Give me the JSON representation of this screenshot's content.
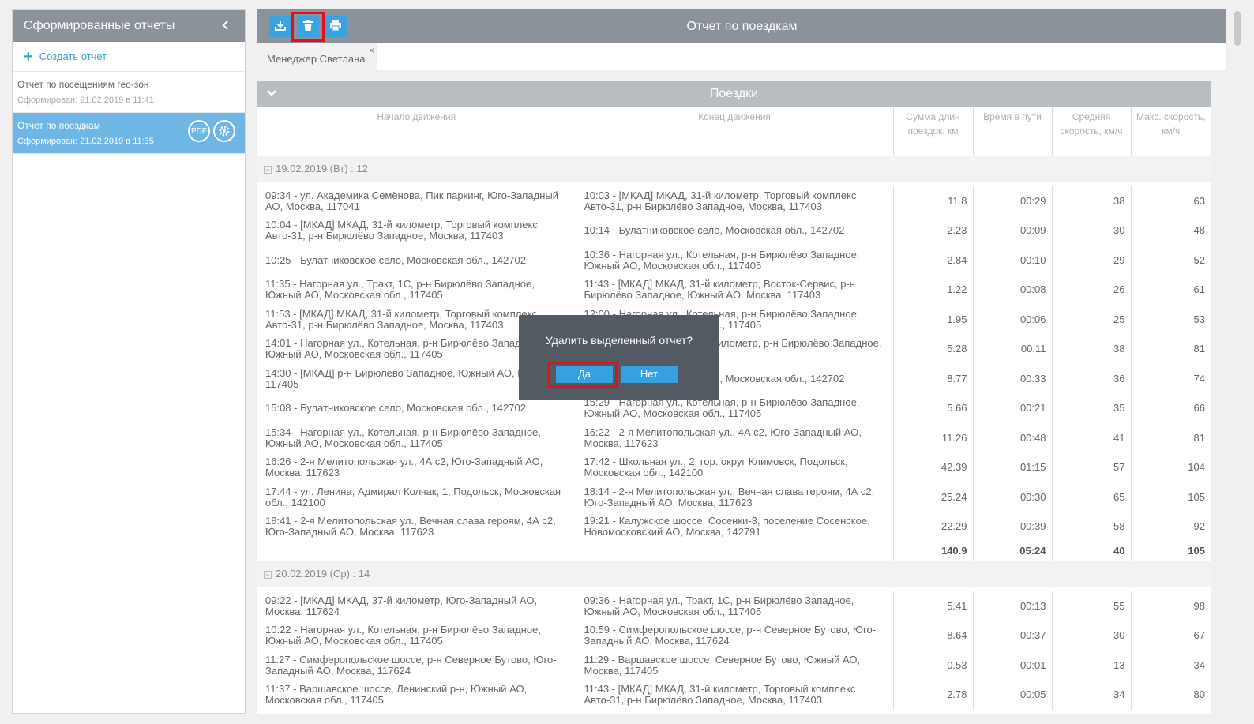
{
  "sidebar": {
    "title": "Сформированные отчеты",
    "collapse_icon": "chevron-left-icon",
    "create_label": "Создать отчет",
    "items": [
      {
        "title": "Отчет по посещениям гео-зон",
        "date": "Сформирован: 21.02.2019 в 11:41"
      },
      {
        "title": "Отчет по поездкам",
        "date": "Сформирован: 21.02.2019 в 11:35",
        "pdf_label": "PDF"
      }
    ]
  },
  "toolbar": {
    "title": "Отчет по поездкам",
    "icons": [
      "download-icon",
      "trash-icon",
      "print-icon"
    ],
    "accent": "#39a4e0"
  },
  "tab": {
    "label": "Менеджер Светлана",
    "close": "×"
  },
  "section": {
    "title": "Поездки"
  },
  "table": {
    "headers": [
      "Начало движения",
      "Конец движения",
      "Сумма длин поездок, км",
      "Время в пути",
      "Средняя скорость, км/ч",
      "Макс. скорость, км/ч"
    ],
    "groups": [
      {
        "label": "19.02.2019 (Вт) : 12",
        "rows": [
          [
            "09:34 - ул. Академика Семёнова, Пик паркинг, Юго-Западный АО, Москва, 117041",
            "10:03 - [МКАД] МКАД, 31-й километр, Торговый комплекс Авто-31, р-н Бирюлёво Западное, Москва, 117403",
            "11.8",
            "00:29",
            "38",
            "63"
          ],
          [
            "10:04 - [МКАД] МКАД, 31-й километр, Торговый комплекс Авто-31, р-н Бирюлёво Западное, Москва, 117403",
            "10:14 - Булатниковское село, Московская обл., 142702",
            "2.23",
            "00:09",
            "30",
            "48"
          ],
          [
            "10:25 - Булатниковское село, Московская обл., 142702",
            "10:36 - Нагорная ул., Котельная, р-н Бирюлёво Западное, Южный АО, Московская обл., 117405",
            "2.84",
            "00:10",
            "29",
            "52"
          ],
          [
            "11:35 - Нагорная ул., Тракт, 1С, р-н Бирюлёво Западное, Южный АО, Московская обл., 117405",
            "11:43 - [МКАД] МКАД, 31-й километр, Восток-Сервис, р-н Бирюлёво Западное, Южный АО, Москва, 117403",
            "1.22",
            "00:08",
            "26",
            "61"
          ],
          [
            "11:53 - [МКАД] МКАД, 31-й километр, Торговый комплекс Авто-31, р-н Бирюлёво Западное, Москва, 117403",
            "12:00 - Нагорная ул., Котельная, р-н Бирюлёво Западное, Южный АО, Московская обл., 117405",
            "1.95",
            "00:06",
            "25",
            "53"
          ],
          [
            "14:01 - Нагорная ул., Котельная, р-н Бирюлёво Западное, Южный АО, Московская обл., 117405",
            "14:11 - [МКАД] МКАД, 31-й километр, р-н Бирюлёво Западное, Москва, 117403",
            "5.28",
            "00:11",
            "38",
            "81"
          ],
          [
            "14:30 - [МКАД] р-н Бирюлёво Западное, Южный АО, Москва, 117405",
            "15:03 - Булатниковское село, Московская обл., 142702",
            "8.77",
            "00:33",
            "36",
            "74"
          ],
          [
            "15:08 - Булатниковское село, Московская обл., 142702",
            "15:29 - Нагорная ул., Котельная, р-н Бирюлёво Западное, Южный АО, Московская обл., 117405",
            "5.66",
            "00:21",
            "35",
            "66"
          ],
          [
            "15:34 - Нагорная ул., Котельная, р-н Бирюлёво Западное, Южный АО, Московская обл., 117405",
            "16:22 - 2-я Мелитопольская ул., 4А с2, Юго-Западный АО, Москва, 117623",
            "11.26",
            "00:48",
            "41",
            "81"
          ],
          [
            "16:26 - 2-я Мелитопольская ул., 4А с2, Юго-Западный АО, Москва, 117623",
            "17:42 - Школьная ул., 2, гор. округ Климовск, Подольск, Московская обл., 142100",
            "42.39",
            "01:15",
            "57",
            "104"
          ],
          [
            "17:44 - ул. Ленина, Адмирал Колчак, 1, Подольск, Московская обл., 142100",
            "18:14 - 2-я Мелитопольская ул., Вечная слава героям, 4А с2, Юго-Западный АО, Москва, 117623",
            "25.24",
            "00:30",
            "65",
            "105"
          ],
          [
            "18:41 - 2-я Мелитопольская ул., Вечная слава героям, 4А с2, Юго-Западный АО, Москва, 117623",
            "19:21 - Калужское шоссе, Сосенки-3, поселение Сосенское, Новомосковский АО, Москва, 142791",
            "22.29",
            "00:39",
            "58",
            "92"
          ]
        ],
        "total": [
          "140.9",
          "05:24",
          "40",
          "105"
        ]
      },
      {
        "label": "20.02.2019 (Ср) : 14",
        "rows": [
          [
            "09:22 - [МКАД] МКАД, 37-й километр, Юго-Западный АО, Москва, 117624",
            "09:36 - Нагорная ул., Тракт, 1С, р-н Бирюлёво Западное, Южный АО, Московская обл., 117405",
            "5.41",
            "00:13",
            "55",
            "98"
          ],
          [
            "10:22 - Нагорная ул., Котельная, р-н Бирюлёво Западное, Южный АО, Московская обл., 117405",
            "10:59 - Симферопольское шоссе, р-н Северное Бутово, Юго-Западный АО, Москва, 117624",
            "8.64",
            "00:37",
            "30",
            "67"
          ],
          [
            "11:27 - Симферопольское шоссе, р-н Северное Бутово, Юго-Западный АО, Москва, 117624",
            "11:29 - Варшавское шоссе, Северное Бутово, Южный АО, Москва, 117405",
            "0.53",
            "00:01",
            "13",
            "34"
          ],
          [
            "11:37 - Варшавское шоссе, Ленинский р-н, Южный АО, Московская обл., 117405",
            "11:43 - [МКАД] МКАД, 31-й километр, Торговый комплекс Авто-31, р-н Бирюлёво Западное, Москва, 117403",
            "2.78",
            "00:05",
            "34",
            "80"
          ]
        ]
      }
    ]
  },
  "modal": {
    "question": "Удалить выделенный отчет?",
    "yes": "Да",
    "no": "Нет"
  }
}
